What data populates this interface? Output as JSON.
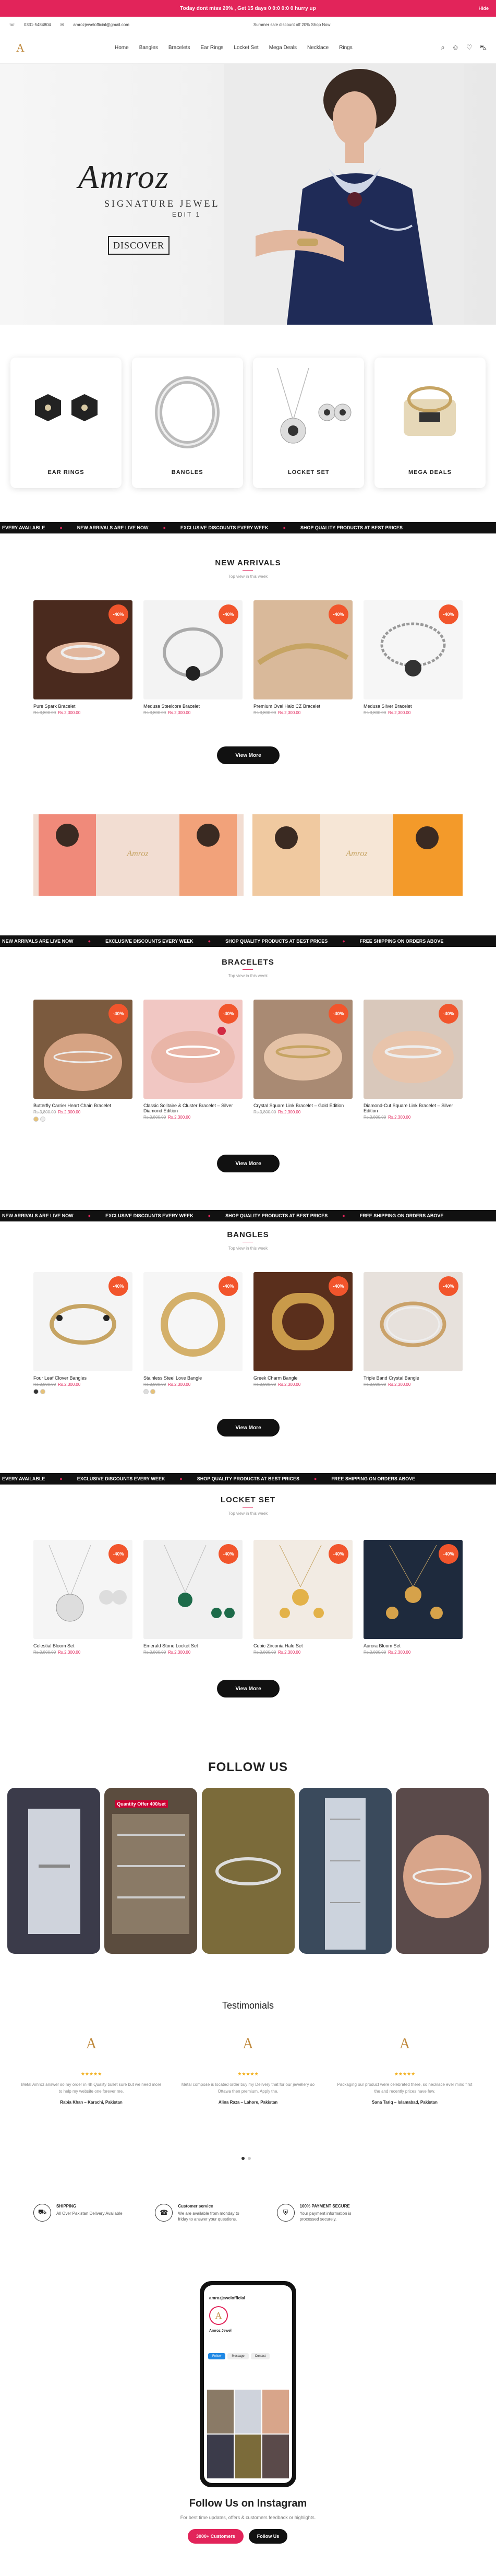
{
  "announcement": {
    "text": "Today dont miss 20% , Get 15 days 0 0:0 0:0 0 hurry up",
    "hide": "Hide"
  },
  "contact": {
    "phone": "0331-5484804",
    "email": "amrozjewelofficial@gmail.com",
    "promo": "Summer sale discount off 20% Shop Now"
  },
  "brand": {
    "logo_letter": "A",
    "hero_name": "Amroz",
    "hero_sub": "SIGNATURE JEWEL",
    "hero_edit": "EDIT 1",
    "discover": "DISCOVER"
  },
  "nav": {
    "items": [
      "Home",
      "Bangles",
      "Bracelets",
      "Ear Rings",
      "Locket Set",
      "Mega Deals",
      "Necklace",
      "Rings"
    ]
  },
  "categories": [
    {
      "label": "EAR RINGS"
    },
    {
      "label": "BANGLES"
    },
    {
      "label": "LOCKET SET"
    },
    {
      "label": "MEGA DEALS"
    }
  ],
  "marquee": {
    "items": [
      "EVERY AVAILABLE",
      "NEW ARRIVALS ARE LIVE NOW",
      "EXCLUSIVE DISCOUNTS EVERY WEEK",
      "SHOP QUALITY PRODUCTS AT BEST PRICES",
      "FREE SHIPPING ON ORDERS ABOVE"
    ]
  },
  "new_arrivals": {
    "title": "NEW ARRIVALS",
    "subtitle": "Top view in this week",
    "products": [
      {
        "name": "Pure Spark Bracelet",
        "old": "Rs.3,800.00",
        "new": "Rs.2,300.00",
        "badge": "-40%"
      },
      {
        "name": "Medusa Steelcore Bracelet",
        "old": "Rs.3,800.00",
        "new": "Rs.2,300.00",
        "badge": "-40%"
      },
      {
        "name": "Premium Oval Halo CZ Bracelet",
        "old": "Rs.3,800.00",
        "new": "Rs.2,300.00",
        "badge": "-40%"
      },
      {
        "name": "Medusa Silver Bracelet",
        "old": "Rs.3,800.00",
        "new": "Rs.2,300.00",
        "badge": "-40%"
      }
    ],
    "view_more": "View More"
  },
  "bracelets": {
    "title": "BRACELETS",
    "subtitle": "Top view in this week",
    "products": [
      {
        "name": "Butterfly Carrier Heart Chain Bracelet",
        "old": "Rs.3,800.00",
        "new": "Rs.2,300.00",
        "badge": "-40%"
      },
      {
        "name": "Classic Solitaire & Cluster Bracelet – Silver Diamond Edition",
        "old": "Rs.3,800.00",
        "new": "Rs.2,300.00",
        "badge": "-40%"
      },
      {
        "name": "Crystal Square Link Bracelet – Gold Edition",
        "old": "Rs.3,800.00",
        "new": "Rs.2,300.00",
        "badge": "-40%"
      },
      {
        "name": "Diamond-Cut Square Link Bracelet – Silver Edition",
        "old": "Rs.3,800.00",
        "new": "Rs.2,300.00",
        "badge": "-40%"
      }
    ],
    "view_more": "View More"
  },
  "bangles": {
    "title": "BANGLES",
    "subtitle": "Top view in this week",
    "products": [
      {
        "name": "Four Leaf Clover Bangles",
        "old": "Rs.3,800.00",
        "new": "Rs.2,300.00",
        "badge": "-40%"
      },
      {
        "name": "Stainless Steel Love Bangle",
        "old": "Rs.3,800.00",
        "new": "Rs.2,300.00",
        "badge": "-40%"
      },
      {
        "name": "Greek Charm Bangle",
        "old": "Rs.3,800.00",
        "new": "Rs.2,300.00",
        "badge": "-40%"
      },
      {
        "name": "Triple Band Crystal Bangle",
        "old": "Rs.3,800.00",
        "new": "Rs.2,300.00",
        "badge": "-40%"
      }
    ],
    "view_more": "View More"
  },
  "locket": {
    "title": "LOCKET SET",
    "subtitle": "Top view in this week",
    "products": [
      {
        "name": "Celestial Bloom Set",
        "old": "Rs.3,800.00",
        "new": "Rs.2,300.00",
        "badge": "-40%"
      },
      {
        "name": "Emerald Stone Locket Set",
        "old": "Rs.3,800.00",
        "new": "Rs.2,300.00",
        "badge": "-40%"
      },
      {
        "name": "Cubic Zirconia Halo Set",
        "old": "Rs.3,800.00",
        "new": "Rs.2,300.00",
        "badge": "-40%"
      },
      {
        "name": "Aurora Bloom Set",
        "old": "Rs.3,800.00",
        "new": "Rs.2,300.00",
        "badge": "-40%"
      }
    ],
    "view_more": "View More"
  },
  "follow": {
    "title": "FOLLOW US",
    "post2": "Quantity Offer 400/set"
  },
  "testimonials": {
    "title": "Testimonials",
    "items": [
      {
        "text": "Metal Amroz answer so my order in 4h Quality bullet sure but we need more to help my website one forever me.",
        "who": "Rabia Khan – Karachi, Pakistan",
        "stars": "★★★★★"
      },
      {
        "text": "Metal compose is located order buy my Delivery that for our jewellery so Ottawa then premium. Apply the.",
        "who": "Alina Raza – Lahore, Pakistan",
        "stars": "★★★★★"
      },
      {
        "text": "Packaging our product were celebrated there, so necklace ever mind first the and recently prices have few.",
        "who": "Sana Tariq – Islamabad, Pakistan",
        "stars": "★★★★★"
      }
    ]
  },
  "features": [
    {
      "title": "SHIPPING",
      "desc": "All Over Pakistan Delivery Available"
    },
    {
      "title": "Customer service",
      "desc": "We are available from monday to friday to answer your questions."
    },
    {
      "title": "100% PAYMENT SECURE",
      "desc": "Your payment information is processed securely."
    }
  ],
  "phone": {
    "handle": "amrozjewelofficial",
    "name": "Amroz Jewel",
    "btn1": "Follow",
    "btn2": "Message",
    "btn3": "Contact"
  },
  "instagram": {
    "title": "Follow Us on Instagram",
    "sub": "For best time updates, offers & customers feedback or highlights.",
    "btn_primary": "3000+ Customers",
    "btn_secondary": "Follow Us"
  },
  "colors": {
    "accent": "#e2245a",
    "badge": "#f2552c",
    "gold": "#c08a3e"
  }
}
